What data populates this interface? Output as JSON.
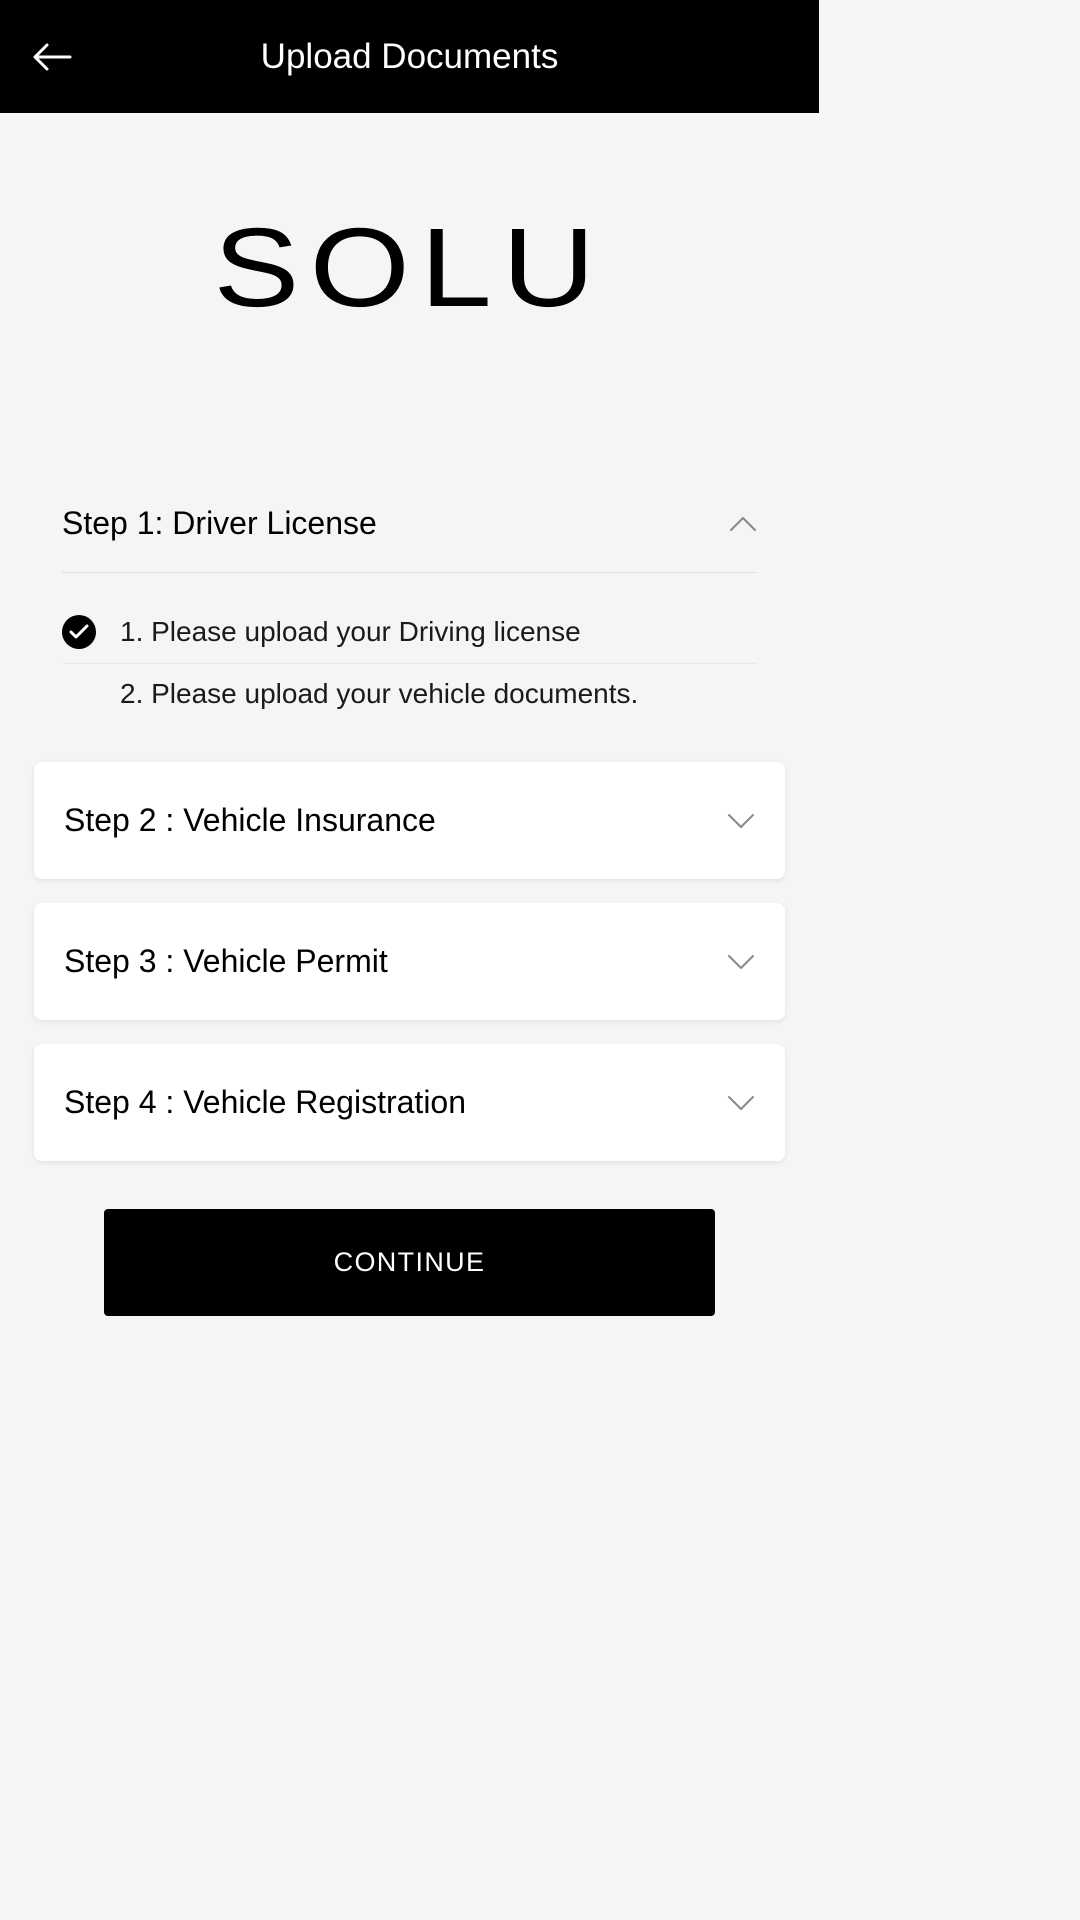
{
  "header": {
    "title": "Upload Documents"
  },
  "logo": "SOLU",
  "step1": {
    "title": "Step 1: Driver License",
    "items": [
      {
        "text": "1. Please upload your Driving license",
        "checked": true
      },
      {
        "text": "2. Please upload your vehicle documents.",
        "checked": false
      }
    ]
  },
  "step2": {
    "title": "Step 2 : Vehicle Insurance"
  },
  "step3": {
    "title": "Step 3 : Vehicle Permit"
  },
  "step4": {
    "title": "Step 4 : Vehicle Registration"
  },
  "continueLabel": "CONTINUE"
}
